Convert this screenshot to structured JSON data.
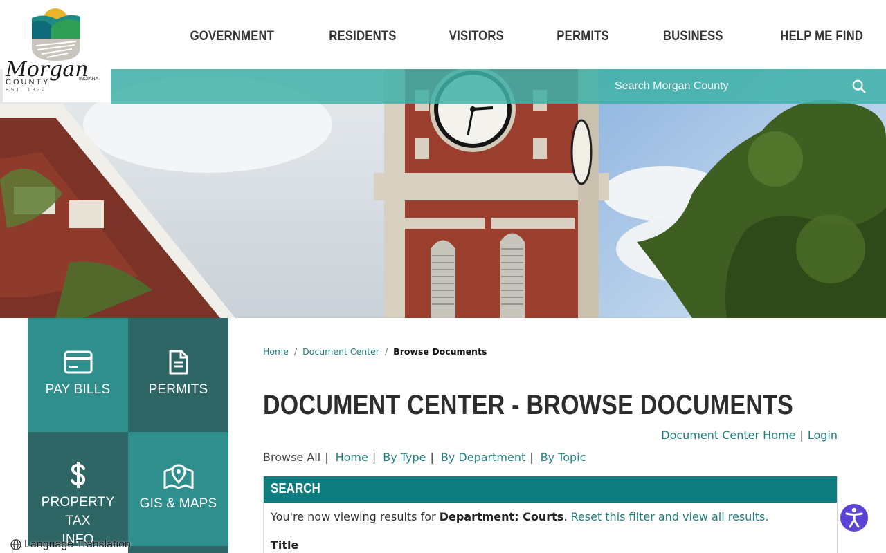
{
  "site": {
    "logo": {
      "name": "Morgan",
      "county": "COUNTY",
      "state": "INDIANA",
      "established": "EST. 1822"
    },
    "nav": [
      {
        "label": "GOVERNMENT"
      },
      {
        "label": "RESIDENTS"
      },
      {
        "label": "VISITORS"
      },
      {
        "label": "PERMITS"
      },
      {
        "label": "BUSINESS"
      },
      {
        "label": "HELP ME FIND"
      }
    ],
    "search": {
      "placeholder": "Search Morgan County"
    }
  },
  "tiles": [
    {
      "label": "PAY BILLS",
      "icon": "credit-card-icon"
    },
    {
      "label": "PERMITS",
      "icon": "document-icon"
    },
    {
      "label_line1": "PROPERTY TAX",
      "label_line2": "INFO",
      "icon": "dollar-icon"
    },
    {
      "label": "GIS & MAPS",
      "icon": "map-pin-icon"
    }
  ],
  "breadcrumb": {
    "home": "Home",
    "document_center": "Document Center",
    "current": "Browse Documents"
  },
  "page": {
    "title": "DOCUMENT CENTER - BROWSE DOCUMENTS",
    "top_links": {
      "home": "Document Center Home",
      "login": "Login"
    },
    "browse": {
      "all": "Browse All",
      "home": "Home",
      "by_type": "By Type",
      "by_department": "By Department",
      "by_topic": "By Topic"
    },
    "search_panel": {
      "heading": "SEARCH",
      "viewing_prefix": "You're now viewing results for ",
      "filter": "Department: Courts",
      "reset": "Reset this filter and view all results.",
      "title_label": "Title"
    }
  },
  "footer": {
    "language": "Language Translation"
  },
  "colors": {
    "teal": "#0e7d7f",
    "teal_light": "#2f8f8c",
    "teal_dark": "#2e6666",
    "link": "#1f7f80",
    "accessibility": "#5b44d6"
  }
}
